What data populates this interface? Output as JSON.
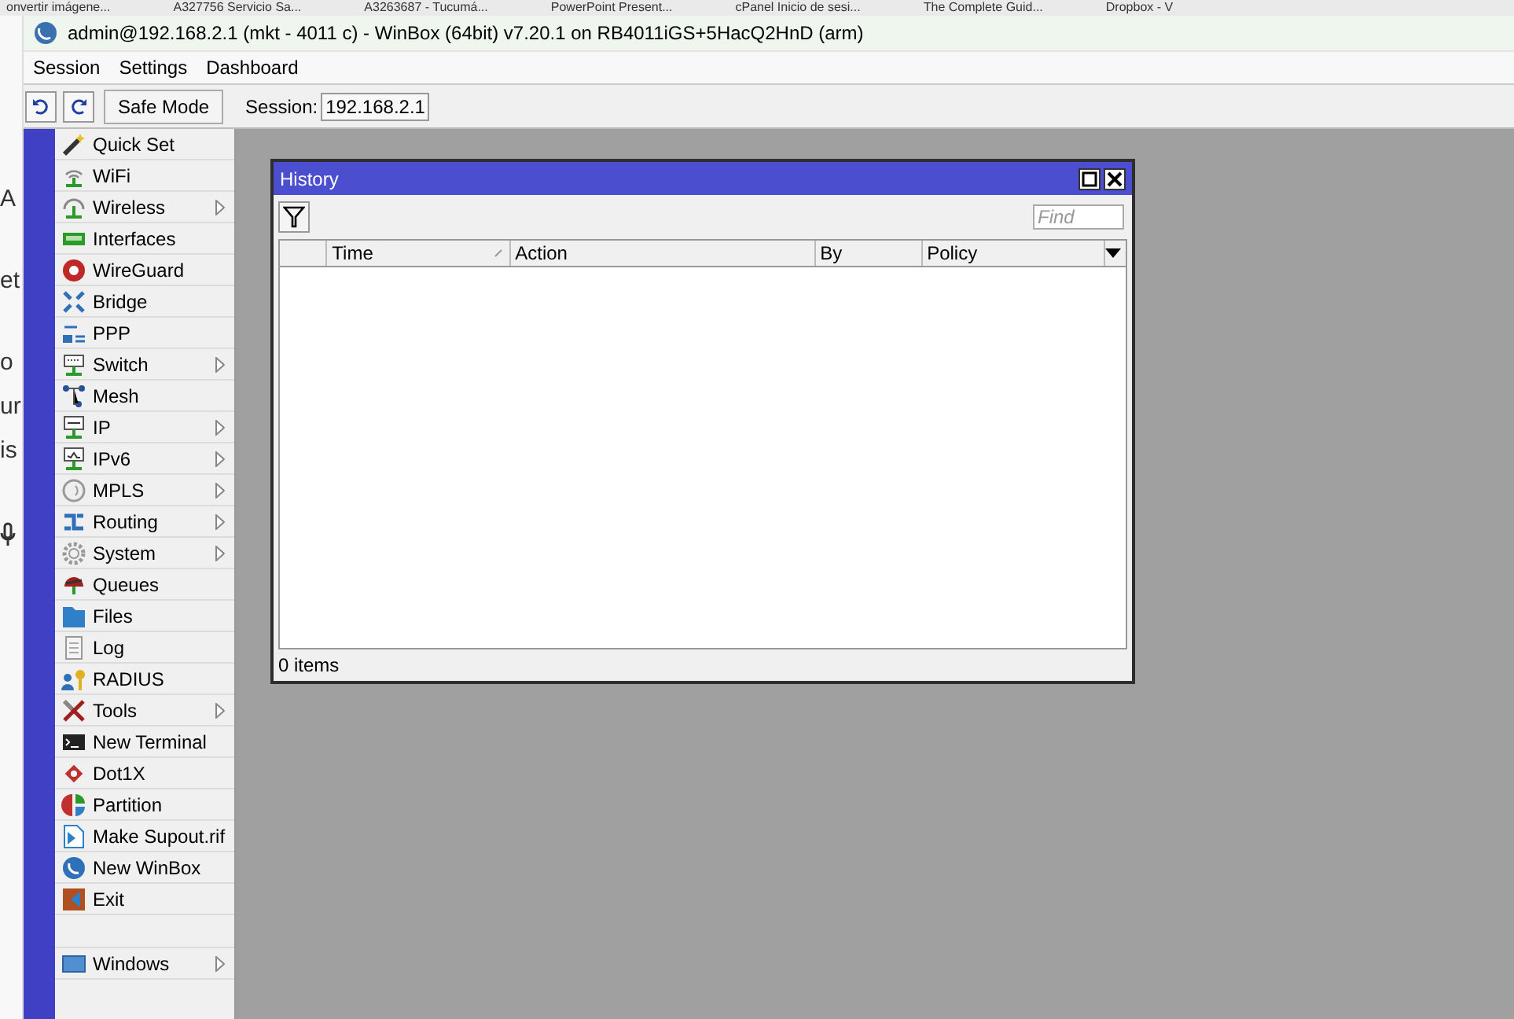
{
  "background": {
    "tabs": [
      "onvertir imágene...",
      "A327756 Servicio Sa...",
      "A3263687 - Tucumá...",
      "PowerPoint Present...",
      "cPanel Inicio de sesi...",
      "The Complete Guid...",
      "Dropbox - V"
    ],
    "fragments": [
      "A",
      "et",
      "o",
      "ur",
      "is"
    ]
  },
  "window": {
    "title": "admin@192.168.2.1 (mkt - 4011 c) - WinBox (64bit) v7.20.1 on RB4011iGS+5HacQ2HnD (arm)"
  },
  "menu_bar": [
    "Session",
    "Settings",
    "Dashboard"
  ],
  "toolbar": {
    "safe_mode": "Safe Mode",
    "session_label": "Session:",
    "session_value": "192.168.2.1"
  },
  "side_menu": [
    {
      "label": "Quick Set",
      "submenu": false
    },
    {
      "label": "WiFi",
      "submenu": false
    },
    {
      "label": "Wireless",
      "submenu": true
    },
    {
      "label": "Interfaces",
      "submenu": false
    },
    {
      "label": "WireGuard",
      "submenu": false
    },
    {
      "label": "Bridge",
      "submenu": false
    },
    {
      "label": "PPP",
      "submenu": false
    },
    {
      "label": "Switch",
      "submenu": true
    },
    {
      "label": "Mesh",
      "submenu": false
    },
    {
      "label": "IP",
      "submenu": true
    },
    {
      "label": "IPv6",
      "submenu": true
    },
    {
      "label": "MPLS",
      "submenu": true
    },
    {
      "label": "Routing",
      "submenu": true
    },
    {
      "label": "System",
      "submenu": true
    },
    {
      "label": "Queues",
      "submenu": false
    },
    {
      "label": "Files",
      "submenu": false
    },
    {
      "label": "Log",
      "submenu": false
    },
    {
      "label": "RADIUS",
      "submenu": false
    },
    {
      "label": "Tools",
      "submenu": true
    },
    {
      "label": "New Terminal",
      "submenu": false
    },
    {
      "label": "Dot1X",
      "submenu": false
    },
    {
      "label": "Partition",
      "submenu": false
    },
    {
      "label": "Make Supout.rif",
      "submenu": false
    },
    {
      "label": "New WinBox",
      "submenu": false
    },
    {
      "label": "Exit",
      "submenu": false
    }
  ],
  "side_menu_bottom": [
    {
      "label": "Windows",
      "submenu": true
    }
  ],
  "history": {
    "title": "History",
    "find_placeholder": "Find",
    "columns": [
      {
        "label": "Time",
        "sorted": true
      },
      {
        "label": "Action",
        "sorted": false
      },
      {
        "label": "By",
        "sorted": false
      },
      {
        "label": "Policy",
        "sorted": false
      }
    ],
    "status": "0 items"
  }
}
